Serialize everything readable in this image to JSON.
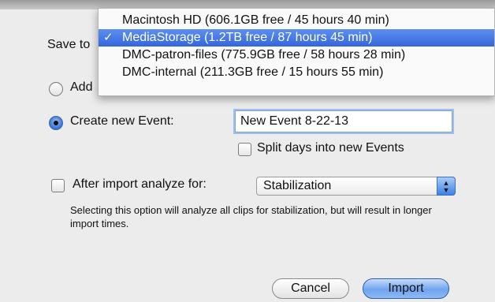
{
  "dialog": {
    "save_to_label": "Save to",
    "add_label": "Add",
    "create_event_label": "Create new Event:",
    "event_name_value": "New Event 8-22-13",
    "split_days_label": "Split days into new Events",
    "analyze_label": "After import analyze for:",
    "analyze_value": "Stabilization",
    "note_text": "Selecting this option will analyze all clips for stabilization, but will result in longer import times.",
    "cancel_label": "Cancel",
    "import_label": "Import",
    "radio_selected": "create_new_event",
    "split_days_checked": false,
    "analyze_checked": false
  },
  "menu": {
    "items": [
      {
        "label": "Macintosh HD (606.1GB free / 45 hours 40 min)",
        "selected": false
      },
      {
        "label": "MediaStorage (1.2TB free / 87 hours 45 min)",
        "selected": true,
        "check": "✓"
      },
      {
        "label": "DMC-patron-files (775.9GB free / 58 hours 28 min)",
        "selected": false
      },
      {
        "label": "DMC-internal (211.3GB free / 15 hours 55 min)",
        "selected": false
      }
    ]
  },
  "colors": {
    "highlight": "#3466dc",
    "focus_ring": "#9cc0f0",
    "background": "#ececec"
  },
  "icons": {
    "popup_arrows": "up-down-arrows-icon",
    "check": "checkmark-icon"
  }
}
